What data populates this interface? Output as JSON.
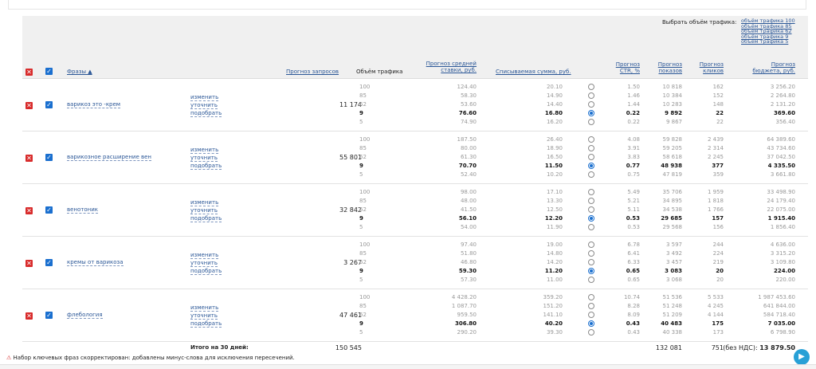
{
  "traffic_selector": {
    "label": "Выбрать объём трафика:",
    "options": [
      "объём трафика 100",
      "объём трафика 85",
      "объём трафика 62",
      "объём трафика 9",
      "объём трафика 5"
    ]
  },
  "header": {
    "phrases": "Фразы ▲",
    "requests": "Прогноз запросов",
    "volume": "Объём трафика",
    "bid_1": "Прогноз средней",
    "bid_2": "ставки, руб.",
    "charge": "Списываемая сумма, руб.",
    "ctr_1": "Прогноз",
    "ctr_2": "CTR, %",
    "shows_1": "Прогноз",
    "shows_2": "показов",
    "clicks_1": "Прогноз",
    "clicks_2": "кликов",
    "budget_1": "Прогноз",
    "budget_2": "бюджета, руб."
  },
  "actions": {
    "edit": "изменить",
    "refine": "уточнить",
    "pick": "подобрать"
  },
  "rows": [
    {
      "phrase": "варикоз это -крем",
      "requests": "11 174",
      "selected": 3,
      "volume": [
        "100",
        "85",
        "62",
        "9",
        "5"
      ],
      "bid": [
        "124.40",
        "58.30",
        "53.60",
        "76.60",
        "74.90"
      ],
      "charge": [
        "20.10",
        "14.90",
        "14.40",
        "16.80",
        "16.20"
      ],
      "ctr": [
        "1.50",
        "1.46",
        "1.44",
        "0.22",
        "0.22"
      ],
      "shows": [
        "10 818",
        "10 384",
        "10 283",
        "9 892",
        "9 867"
      ],
      "clicks": [
        "162",
        "152",
        "148",
        "22",
        "22"
      ],
      "budget": [
        "3 256.20",
        "2 264.80",
        "2 131.20",
        "369.60",
        "356.40"
      ]
    },
    {
      "phrase": "варикозное расширение вен",
      "requests": "55 801",
      "selected": 3,
      "volume": [
        "100",
        "85",
        "62",
        "9",
        "5"
      ],
      "bid": [
        "187.50",
        "80.00",
        "61.30",
        "70.70",
        "52.40"
      ],
      "charge": [
        "26.40",
        "18.90",
        "16.50",
        "11.50",
        "10.20"
      ],
      "ctr": [
        "4.08",
        "3.91",
        "3.83",
        "0.77",
        "0.75"
      ],
      "shows": [
        "59 828",
        "59 205",
        "58 618",
        "48 938",
        "47 819"
      ],
      "clicks": [
        "2 439",
        "2 314",
        "2 245",
        "377",
        "359"
      ],
      "budget": [
        "64 389.60",
        "43 734.60",
        "37 042.50",
        "4 335.50",
        "3 661.80"
      ]
    },
    {
      "phrase": "венотоник",
      "requests": "32 842",
      "selected": 3,
      "volume": [
        "100",
        "85",
        "62",
        "9",
        "5"
      ],
      "bid": [
        "98.00",
        "48.00",
        "41.50",
        "56.10",
        "54.00"
      ],
      "charge": [
        "17.10",
        "13.30",
        "12.50",
        "12.20",
        "11.90"
      ],
      "ctr": [
        "5.49",
        "5.21",
        "5.11",
        "0.53",
        "0.53"
      ],
      "shows": [
        "35 706",
        "34 895",
        "34 538",
        "29 685",
        "29 568"
      ],
      "clicks": [
        "1 959",
        "1 818",
        "1 766",
        "157",
        "156"
      ],
      "budget": [
        "33 498.90",
        "24 179.40",
        "22 075.00",
        "1 915.40",
        "1 856.40"
      ]
    },
    {
      "phrase": "кремы от варикоза",
      "requests": "3 267",
      "selected": 3,
      "volume": [
        "100",
        "85",
        "62",
        "9",
        "5"
      ],
      "bid": [
        "97.40",
        "51.80",
        "46.80",
        "59.30",
        "57.30"
      ],
      "charge": [
        "19.00",
        "14.80",
        "14.20",
        "11.20",
        "11.00"
      ],
      "ctr": [
        "6.78",
        "6.41",
        "6.33",
        "0.65",
        "0.65"
      ],
      "shows": [
        "3 597",
        "3 492",
        "3 457",
        "3 083",
        "3 068"
      ],
      "clicks": [
        "244",
        "224",
        "219",
        "20",
        "20"
      ],
      "budget": [
        "4 636.00",
        "3 315.20",
        "3 109.80",
        "224.00",
        "220.00"
      ]
    },
    {
      "phrase": "флебология",
      "requests": "47 461",
      "selected": 3,
      "volume": [
        "100",
        "85",
        "62",
        "9",
        "5"
      ],
      "bid": [
        "4 428.20",
        "1 087.70",
        "959.50",
        "306.80",
        "290.20"
      ],
      "charge": [
        "359.20",
        "151.20",
        "141.10",
        "40.20",
        "39.30"
      ],
      "ctr": [
        "10.74",
        "8.28",
        "8.09",
        "0.43",
        "0.43"
      ],
      "shows": [
        "51 536",
        "51 248",
        "51 209",
        "40 483",
        "40 338"
      ],
      "clicks": [
        "5 533",
        "4 245",
        "4 144",
        "175",
        "173"
      ],
      "budget": [
        "1 987 453.60",
        "641 844.00",
        "584 718.40",
        "7 035.00",
        "6 798.90"
      ]
    }
  ],
  "totals": {
    "label": "Итого на 30 дней:",
    "requests": "150 545",
    "shows": "132 081",
    "clicks": "751",
    "budget_prefix": "(без НДС):",
    "budget": "13 879.50"
  },
  "notice": "Набор ключевых фраз скорректирован: добавлены минус-слова для исключения пересечений.",
  "colors": {
    "link": "#2b5797",
    "delete": "#d82b2b",
    "check": "#1a6fcf",
    "header_bg": "#f0f0f0"
  }
}
